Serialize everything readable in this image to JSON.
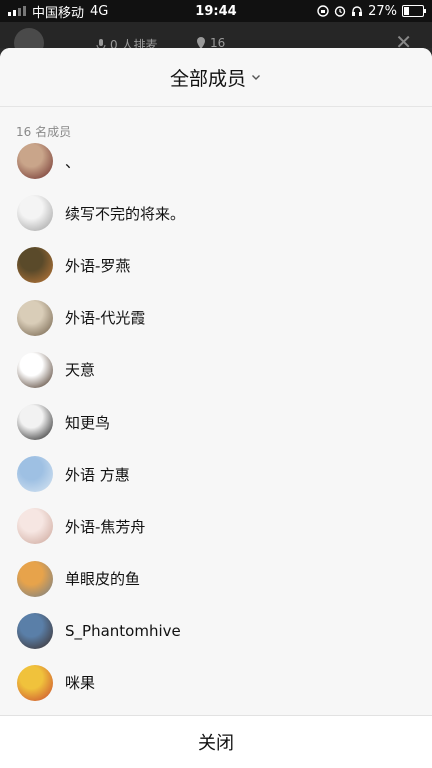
{
  "status_bar": {
    "carrier": "中国移动",
    "network": "4G",
    "time": "19:44",
    "battery": "27%",
    "battery_level": 0.27
  },
  "background": {
    "rank_text": "0 人排麦",
    "count_text": "16",
    "close_icon": "close-icon"
  },
  "sheet": {
    "title": "全部成员",
    "title_icon": "chevron-down-icon",
    "member_count": "16 名成员",
    "close_label": "关闭"
  },
  "members": [
    {
      "name": "、",
      "avatar_colors": [
        "#c9a58a",
        "#6a2a28"
      ]
    },
    {
      "name": "续写不完的将来。",
      "avatar_colors": [
        "#f4f4f4",
        "#9a9a9a"
      ]
    },
    {
      "name": "外语-罗燕",
      "avatar_colors": [
        "#5a4a2a",
        "#c27b3a"
      ]
    },
    {
      "name": "外语-代光霞",
      "avatar_colors": [
        "#d9cdb8",
        "#6b5a44"
      ]
    },
    {
      "name": "天意",
      "avatar_colors": [
        "#ffffff",
        "#3a2414"
      ]
    },
    {
      "name": "知更鸟",
      "avatar_colors": [
        "#f2f2f2",
        "#111111"
      ]
    },
    {
      "name": "外语 方惠",
      "avatar_colors": [
        "#9ec0e3",
        "#d9e6f2"
      ]
    },
    {
      "name": "外语-焦芳舟",
      "avatar_colors": [
        "#f6e6e2",
        "#caa397"
      ]
    },
    {
      "name": "单眼皮的鱼",
      "avatar_colors": [
        "#e7a34b",
        "#6f7e8c"
      ]
    },
    {
      "name": "S_Phantomhive",
      "avatar_colors": [
        "#5a7fa8",
        "#3a2a24"
      ]
    },
    {
      "name": "咪果",
      "avatar_colors": [
        "#f0c23c",
        "#c8432f"
      ]
    }
  ]
}
